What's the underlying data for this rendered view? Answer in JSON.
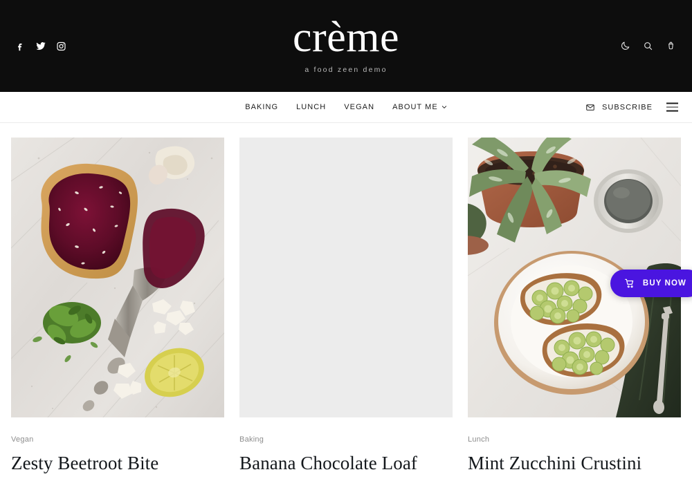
{
  "header": {
    "brand_title": "crème",
    "brand_tagline": "a food zeen demo",
    "social": [
      {
        "name": "facebook-icon",
        "label": "Facebook"
      },
      {
        "name": "twitter-icon",
        "label": "Twitter"
      },
      {
        "name": "instagram-icon",
        "label": "Instagram"
      }
    ],
    "utils": [
      {
        "name": "moon-icon",
        "label": "Dark mode"
      },
      {
        "name": "search-icon",
        "label": "Search"
      },
      {
        "name": "cart-icon",
        "label": "Cart"
      }
    ],
    "background_color": "#0d0d0d"
  },
  "nav": {
    "items": [
      {
        "label": "BAKING",
        "has_dropdown": false
      },
      {
        "label": "LUNCH",
        "has_dropdown": false
      },
      {
        "label": "VEGAN",
        "has_dropdown": false
      },
      {
        "label": "ABOUT ME",
        "has_dropdown": true
      }
    ],
    "subscribe_label": "SUBSCRIBE",
    "menu_icon": "hamburger-icon"
  },
  "buy_now": {
    "label": "BUY NOW",
    "icon": "shopping-cart-icon",
    "color": "#4a15e0"
  },
  "posts": [
    {
      "category": "Vegan",
      "title": "Zesty Beetroot Bite",
      "image": "beetroot-toast-on-marble",
      "image_loaded": true
    },
    {
      "category": "Baking",
      "title": "Banana Chocolate Loaf",
      "image": "image-placeholder",
      "image_loaded": false,
      "placeholder_color": "#ececec"
    },
    {
      "category": "Lunch",
      "title": "Mint Zucchini Crustini",
      "image": "zucchini-toast-with-plant-and-mug",
      "image_loaded": true
    }
  ]
}
